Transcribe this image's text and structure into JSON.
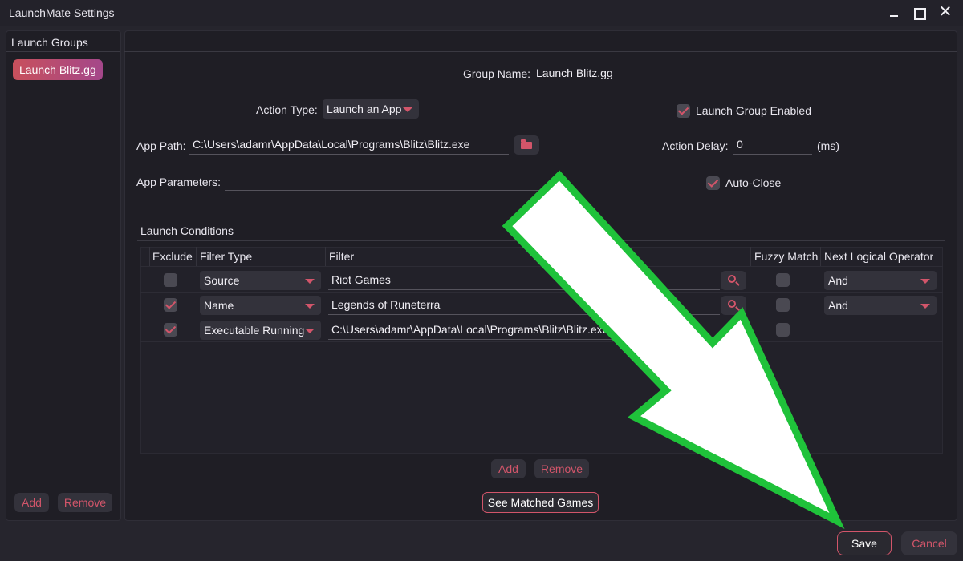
{
  "window": {
    "title": "LaunchMate Settings"
  },
  "sidebar": {
    "header": "Launch Groups",
    "groups": [
      {
        "label": "Launch Blitz.gg"
      }
    ],
    "add_label": "Add",
    "remove_label": "Remove"
  },
  "form": {
    "group_name_label": "Group Name:",
    "group_name_value": "Launch Blitz.gg",
    "action_type_label": "Action Type:",
    "action_type_value": "Launch an App",
    "launch_group_enabled_label": "Launch Group Enabled",
    "launch_group_enabled_checked": true,
    "app_path_label": "App Path:",
    "app_path_value": "C:\\Users\\adamr\\AppData\\Local\\Programs\\Blitz\\Blitz.exe",
    "action_delay_label": "Action Delay:",
    "action_delay_value": "0",
    "action_delay_unit": "(ms)",
    "app_parameters_label": "App Parameters:",
    "app_parameters_value": "",
    "auto_close_label": "Auto-Close",
    "auto_close_checked": true
  },
  "conditions": {
    "header": "Launch Conditions",
    "columns": {
      "exclude": "Exclude",
      "filter_type": "Filter Type",
      "filter": "Filter",
      "fuzzy_match": "Fuzzy Match",
      "next_operator": "Next Logical Operator"
    },
    "rows": [
      {
        "exclude": false,
        "filter_type": "Source",
        "filter": "Riot Games",
        "fuzzy": false,
        "operator": "And"
      },
      {
        "exclude": true,
        "filter_type": "Name",
        "filter": "Legends of Runeterra",
        "fuzzy": false,
        "operator": "And"
      },
      {
        "exclude": true,
        "filter_type": "Executable Running",
        "filter": "C:\\Users\\adamr\\AppData\\Local\\Programs\\Blitz\\Blitz.exe",
        "fuzzy": false,
        "operator": ""
      }
    ],
    "add_label": "Add",
    "remove_label": "Remove"
  },
  "see_matched_label": "See Matched Games",
  "footer": {
    "save_label": "Save",
    "cancel_label": "Cancel"
  },
  "colors": {
    "accent": "#d2556a",
    "annotation_arrow": "#1fc23a"
  }
}
